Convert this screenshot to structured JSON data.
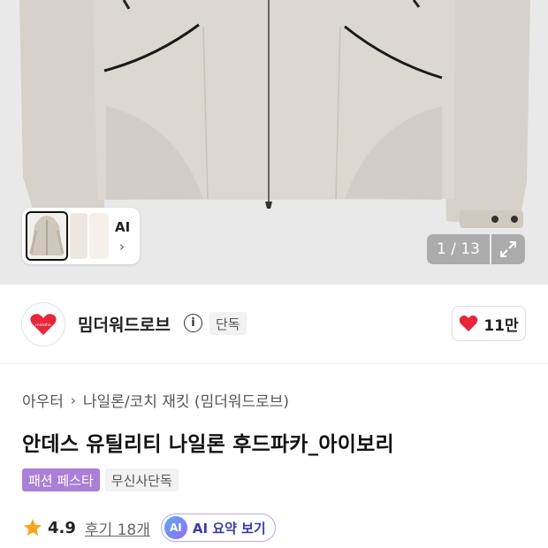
{
  "gallery": {
    "thumbnail_ai_label": "AI",
    "counter": "1 / 13"
  },
  "brand": {
    "name": "밈더워드로브",
    "exclusive_badge": "단독",
    "likes": "11만",
    "colors": {
      "heart": "#e8263a"
    }
  },
  "product": {
    "breadcrumb": [
      "아우터",
      "나일론/코치 재킷 (밈더워드로브)"
    ],
    "title": "안데스 유틸리티 나일론 후드파카_아이보리",
    "tags": [
      "패션 페스타",
      "무신사단독"
    ],
    "rating": "4.9",
    "reviews": "후기 18개",
    "ai_summary_badge": "AI",
    "ai_summary_label": "AI 요약 보기"
  },
  "icons": {
    "info": "info-icon",
    "heart": "heart-icon",
    "star": "star-icon",
    "expand": "expand-icon",
    "chevron": "chevron-right-icon"
  }
}
